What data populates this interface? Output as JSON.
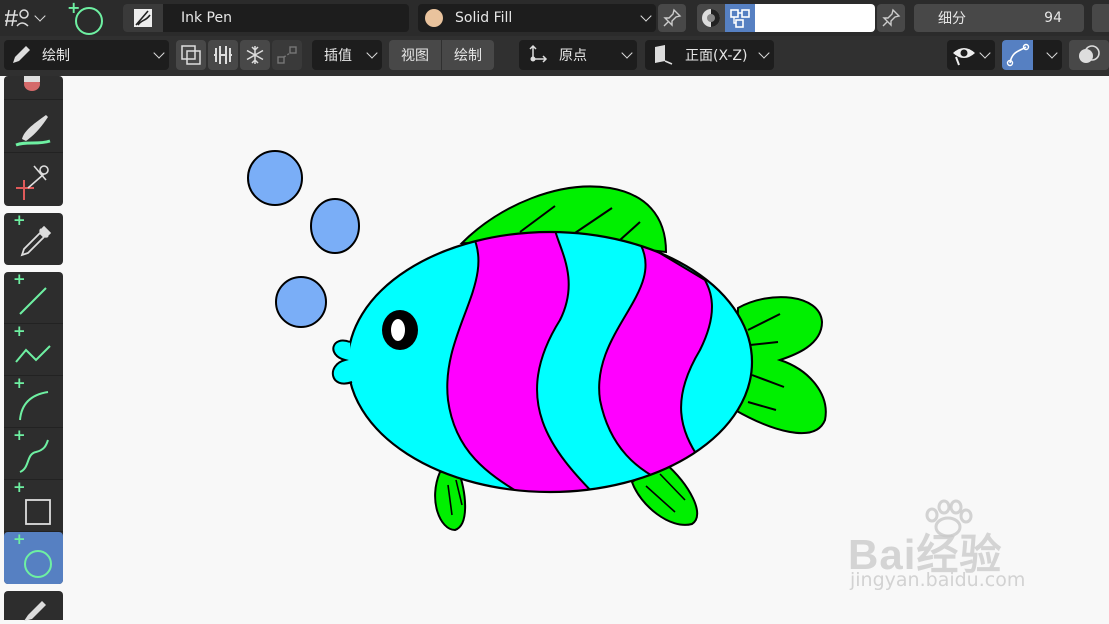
{
  "header": {
    "brush_name": "Ink Pen",
    "material_name": "Solid Fill",
    "subdivide_label": "细分",
    "subdivide_value": "94",
    "color_field_value": ""
  },
  "toolbar": {
    "mode_label": "绘制",
    "interpolate_label": "插值",
    "view_menu": "视图",
    "draw_menu": "绘制",
    "origin_label": "原点",
    "orientation_label": "正面(X-Z)"
  },
  "tools": [
    {
      "name": "erase",
      "active": false
    },
    {
      "name": "tint",
      "active": false
    },
    {
      "name": "cutter",
      "active": false
    },
    {
      "name": "eyedropper",
      "active": false
    },
    {
      "name": "line",
      "active": false
    },
    {
      "name": "polyline",
      "active": false
    },
    {
      "name": "arc",
      "active": false
    },
    {
      "name": "curve",
      "active": false
    },
    {
      "name": "box",
      "active": false
    },
    {
      "name": "circle",
      "active": true
    },
    {
      "name": "annotate",
      "active": false
    }
  ],
  "colors": {
    "material_swatch": "#e9c39d",
    "active_tool": "#5680c2",
    "accent_green": "#6ef0a2",
    "fish_cyan": "#00ffff",
    "fish_magenta": "#ff00ff",
    "fin_green": "#00f000",
    "bubble_blue": "#7aaef7"
  },
  "watermark": {
    "brand": "Bai经验",
    "url": "jingyan.baidu.com"
  }
}
